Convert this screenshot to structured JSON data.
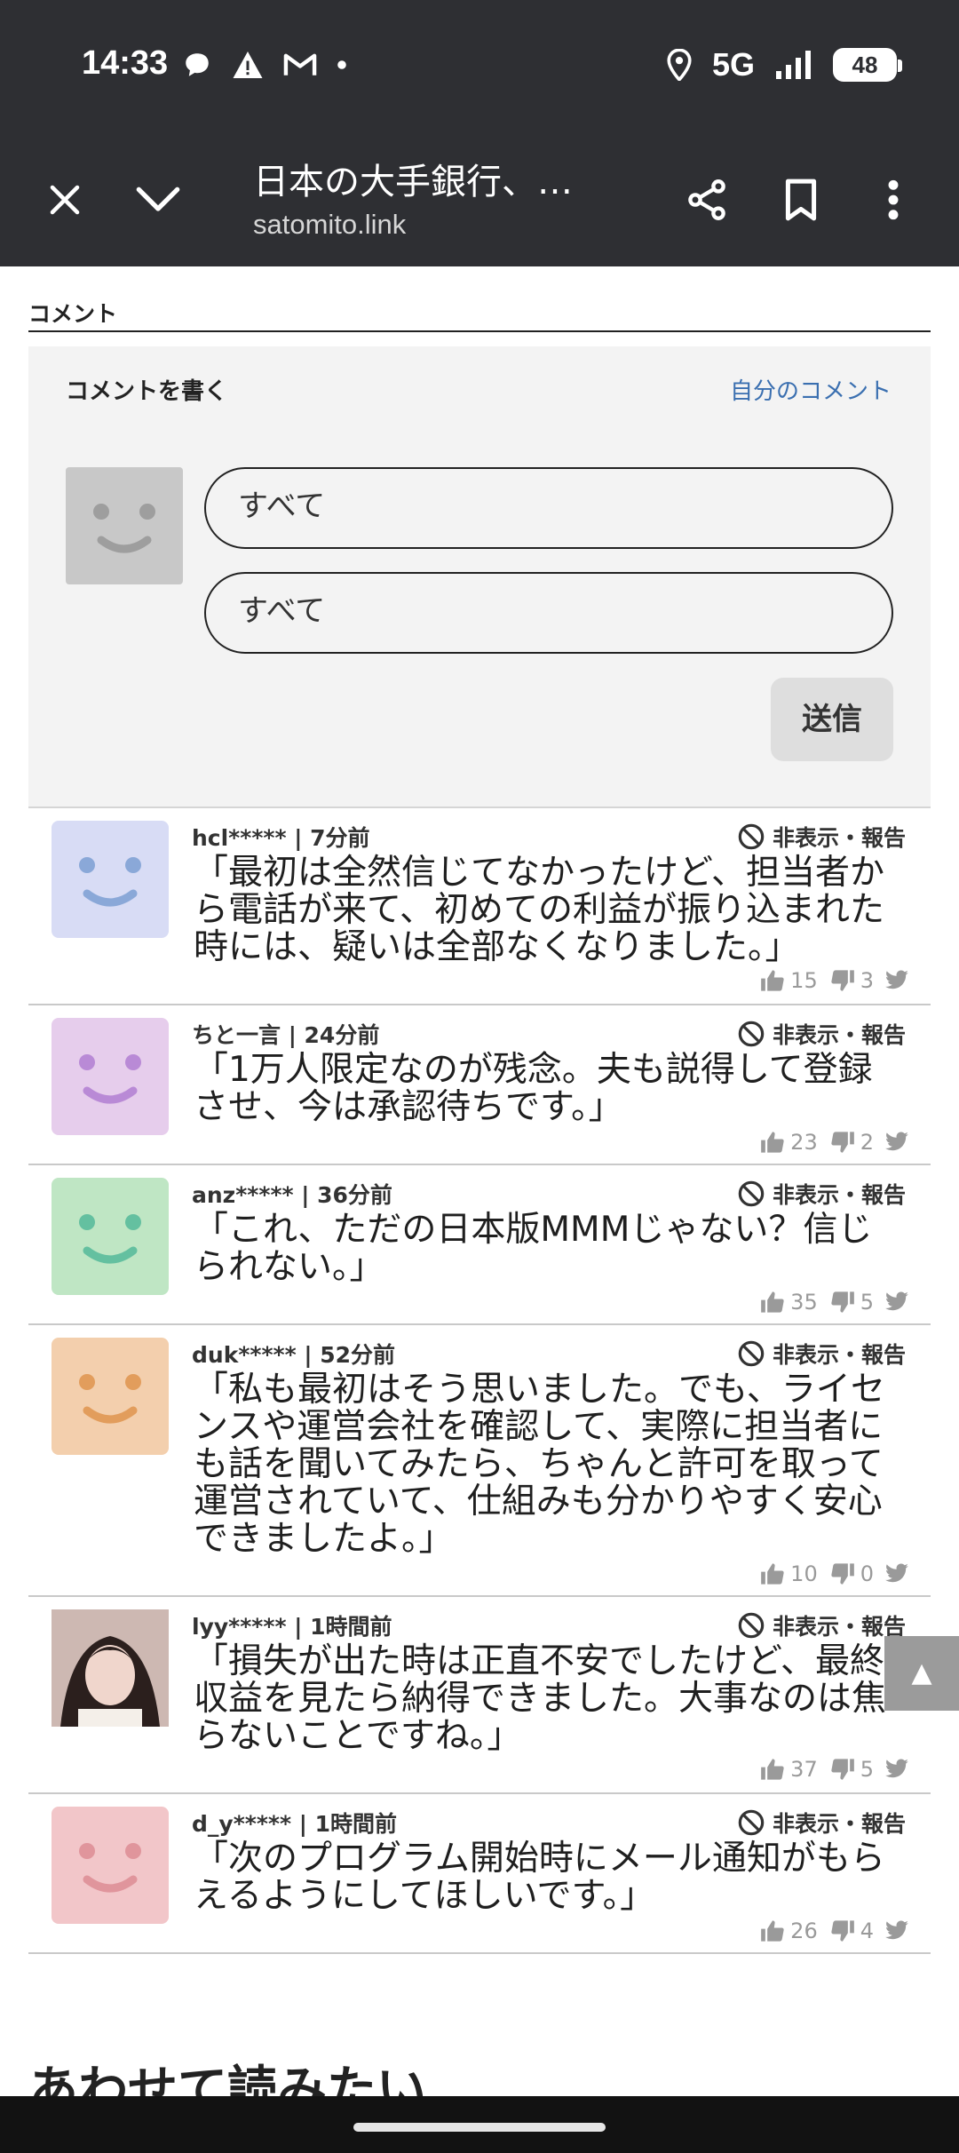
{
  "status_bar": {
    "time": "14:33",
    "network": "5G",
    "battery": "48"
  },
  "browser": {
    "title": "日本の大手銀行、…",
    "url": "satomito.link"
  },
  "comments_section": {
    "heading": "コメント",
    "compose": {
      "title": "コメントを書く",
      "my_comments_link": "自分のコメント",
      "field1": "すべて",
      "field2": "すべて",
      "send_label": "送信"
    },
    "report_label": "非表示・報告",
    "items": [
      {
        "meta": "hcl***** | 7分前",
        "text": "「最初は全然信じてなかったけど、担当者から電話が来て、初めての利益が振り込まれた時には、疑いは全部なくなりました。」",
        "likes": "15",
        "dislikes": "3",
        "avatar_color": "#d8dcf5",
        "face_color": "#8aa8d8"
      },
      {
        "meta": "ちと一言 | 24分前",
        "text": "「1万人限定なのが残念。夫も説得して登録させ、今は承認待ちです。」",
        "likes": "23",
        "dislikes": "2",
        "avatar_color": "#e6cdec",
        "face_color": "#b98ad6"
      },
      {
        "meta": "anz***** | 36分前",
        "text": "「これ、ただの日本版MMMじゃない？信じられない。」",
        "likes": "35",
        "dislikes": "5",
        "avatar_color": "#bfe6c4",
        "face_color": "#64c0a0"
      },
      {
        "meta": "duk***** | 52分前",
        "text": "「私も最初はそう思いました。でも、ライセンスや運営会社を確認して、実際に担当者にも話を聞いてみたら、ちゃんと許可を取って運営されていて、仕組みも分かりやすく安心できましたよ。」",
        "likes": "10",
        "dislikes": "0",
        "avatar_color": "#f3cfad",
        "face_color": "#e29d5c"
      },
      {
        "meta": "lyy***** | 1時間前",
        "text": "「損失が出た時は正直不安でしたけど、最終収益を見たら納得できました。大事なのは焦らないことですね。」",
        "likes": "37",
        "dislikes": "5",
        "avatar_color": "#d9c4c0",
        "face_color": "#6b4a44"
      },
      {
        "meta": "d_y***** | 1時間前",
        "text": "「次のプログラム開始時にメール通知がもらえるようにしてほしいです。」",
        "likes": "26",
        "dislikes": "4",
        "avatar_color": "#f2c6c9",
        "face_color": "#e0959c"
      }
    ]
  },
  "scroll_top_label": "▲",
  "related_heading": "あわせて読みたい"
}
